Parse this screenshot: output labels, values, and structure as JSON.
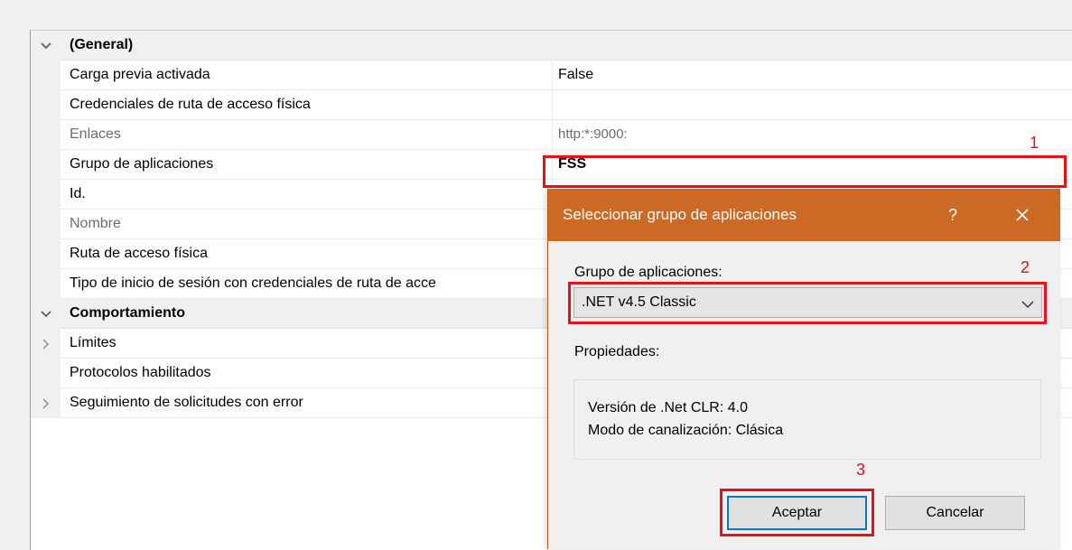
{
  "properties": {
    "general": {
      "label": "(General)"
    },
    "rows": [
      {
        "name": "Carga previa activada",
        "value": "False"
      },
      {
        "name": "Credenciales de ruta de acceso física",
        "value": ""
      },
      {
        "name": "Enlaces",
        "value": "http:*:9000:"
      },
      {
        "name": "Grupo de aplicaciones",
        "value": "FSS"
      },
      {
        "name": "Id.",
        "value": ""
      },
      {
        "name": "Nombre",
        "value": ""
      },
      {
        "name": "Ruta de acceso física",
        "value": ""
      },
      {
        "name": "Tipo de inicio de sesión con credenciales de ruta de acce",
        "value": ""
      }
    ],
    "behavior": {
      "label": "Comportamiento"
    },
    "behavior_rows": [
      {
        "name": "Límites"
      },
      {
        "name": "Protocolos habilitados"
      },
      {
        "name": "Seguimiento de solicitudes con error"
      }
    ]
  },
  "annotations": {
    "one": "1",
    "two": "2",
    "three": "3"
  },
  "dialog": {
    "title": "Seleccionar grupo de aplicaciones",
    "help": "?",
    "app_pool_label": "Grupo de aplicaciones:",
    "app_pool_value": ".NET v4.5 Classic",
    "properties_label": "Propiedades:",
    "clr_version": "Versión de .Net CLR: 4.0",
    "pipeline_mode": "Modo de canalización: Clásica",
    "ok_label": "Aceptar",
    "cancel_label": "Cancelar"
  },
  "colors": {
    "title_bar": "#cc6a25",
    "highlight": "#e8111a",
    "focus": "#0078d7"
  },
  "icons": {
    "expanded": "chevron-down-icon",
    "collapsed": "chevron-right-icon",
    "close": "close-icon",
    "dropdown": "chevron-down-icon"
  }
}
